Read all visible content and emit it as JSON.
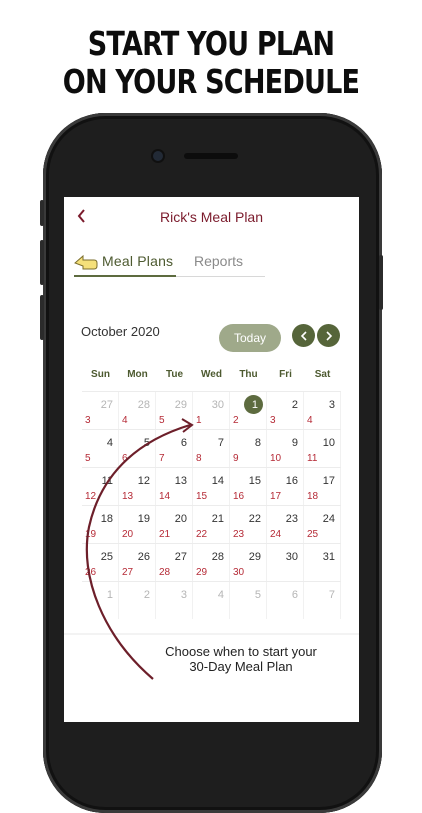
{
  "headline": {
    "line1": "START YOU PLAN",
    "line2": "ON YOUR SCHEDULE"
  },
  "header": {
    "back_icon": "chevron-left-icon",
    "title": "Rick's Meal Plan"
  },
  "tabs": {
    "meal_plans": "Meal Plans",
    "reports": "Reports"
  },
  "calendar": {
    "month": "October 2020",
    "today_label": "Today",
    "weekdays": [
      "Sun",
      "Mon",
      "Tue",
      "Wed",
      "Thu",
      "Fri",
      "Sat"
    ],
    "selected_day": "1",
    "weeks": [
      [
        {
          "d": "27",
          "o": true,
          "p": "3"
        },
        {
          "d": "28",
          "o": true,
          "p": "4"
        },
        {
          "d": "29",
          "o": true,
          "p": "5"
        },
        {
          "d": "30",
          "o": true,
          "p": "1"
        },
        {
          "d": "1",
          "o": false,
          "p": "2",
          "sel": true
        },
        {
          "d": "2",
          "o": false,
          "p": "3"
        },
        {
          "d": "3",
          "o": false,
          "p": "4"
        }
      ],
      [
        {
          "d": "4",
          "p": "5"
        },
        {
          "d": "5",
          "p": "6"
        },
        {
          "d": "6",
          "p": "7"
        },
        {
          "d": "7",
          "p": "8"
        },
        {
          "d": "8",
          "p": "9"
        },
        {
          "d": "9",
          "p": "10"
        },
        {
          "d": "10",
          "p": "11"
        }
      ],
      [
        {
          "d": "11",
          "p": "12"
        },
        {
          "d": "12",
          "p": "13"
        },
        {
          "d": "13",
          "p": "14"
        },
        {
          "d": "14",
          "p": "15"
        },
        {
          "d": "15",
          "p": "16"
        },
        {
          "d": "16",
          "p": "17"
        },
        {
          "d": "17",
          "p": "18"
        }
      ],
      [
        {
          "d": "18",
          "p": "19"
        },
        {
          "d": "19",
          "p": "20"
        },
        {
          "d": "20",
          "p": "21"
        },
        {
          "d": "21",
          "p": "22"
        },
        {
          "d": "22",
          "p": "23"
        },
        {
          "d": "23",
          "p": "24"
        },
        {
          "d": "24",
          "p": "25"
        }
      ],
      [
        {
          "d": "25",
          "p": "26"
        },
        {
          "d": "26",
          "p": "27"
        },
        {
          "d": "27",
          "p": "28"
        },
        {
          "d": "28",
          "p": "29"
        },
        {
          "d": "29",
          "p": "30"
        },
        {
          "d": "30",
          "p": ""
        },
        {
          "d": "31",
          "p": ""
        }
      ],
      [
        {
          "d": "1",
          "o": true,
          "p": ""
        },
        {
          "d": "2",
          "o": true,
          "p": ""
        },
        {
          "d": "3",
          "o": true,
          "p": ""
        },
        {
          "d": "4",
          "o": true,
          "p": ""
        },
        {
          "d": "5",
          "o": true,
          "p": ""
        },
        {
          "d": "6",
          "o": true,
          "p": ""
        },
        {
          "d": "7",
          "o": true,
          "p": ""
        }
      ]
    ]
  },
  "caption": {
    "line1": "Choose when to start your",
    "line2": "30-Day Meal Plan"
  },
  "colors": {
    "maroon": "#7b1b2c",
    "olive": "#5d6b3f",
    "olive_light": "#9fa98a",
    "plan_red": "#b52a36"
  }
}
